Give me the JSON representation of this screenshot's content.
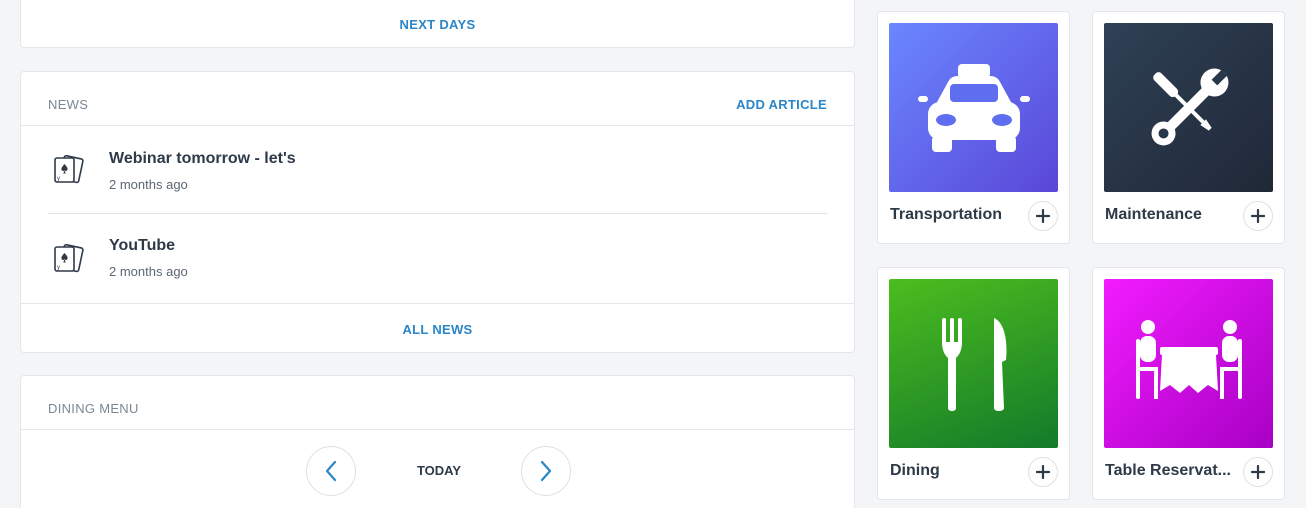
{
  "next_days": {
    "link_label": "NEXT DAYS"
  },
  "news": {
    "title": "NEWS",
    "add_label": "ADD ARTICLE",
    "items": [
      {
        "title": "Webinar tomorrow - let's",
        "time": "2 months ago",
        "icon": "playing-cards-icon"
      },
      {
        "title": "YouTube",
        "time": "2 months ago",
        "icon": "playing-cards-icon"
      }
    ],
    "all_label": "ALL NEWS"
  },
  "dining_menu": {
    "title": "DINING MENU",
    "day_label": "TODAY",
    "prev_icon": "chevron-left-icon",
    "next_icon": "chevron-right-icon"
  },
  "services": [
    {
      "label": "Transportation",
      "icon": "taxi-icon",
      "color_from": "#6a87ff",
      "color_to": "#5a47d8"
    },
    {
      "label": "Maintenance",
      "icon": "tools-icon",
      "color_from": "#2e4155",
      "color_to": "#202837"
    },
    {
      "label": "Dining",
      "icon": "fork-knife-icon",
      "color_from": "#4cbd1e",
      "color_to": "#137a2a"
    },
    {
      "label": "Table Reservat...",
      "icon": "table-reservation-icon",
      "color_from": "#f21cff",
      "color_to": "#a800c4"
    }
  ],
  "colors": {
    "link": "#2a86c8",
    "page_bg": "#f4f5f7"
  }
}
